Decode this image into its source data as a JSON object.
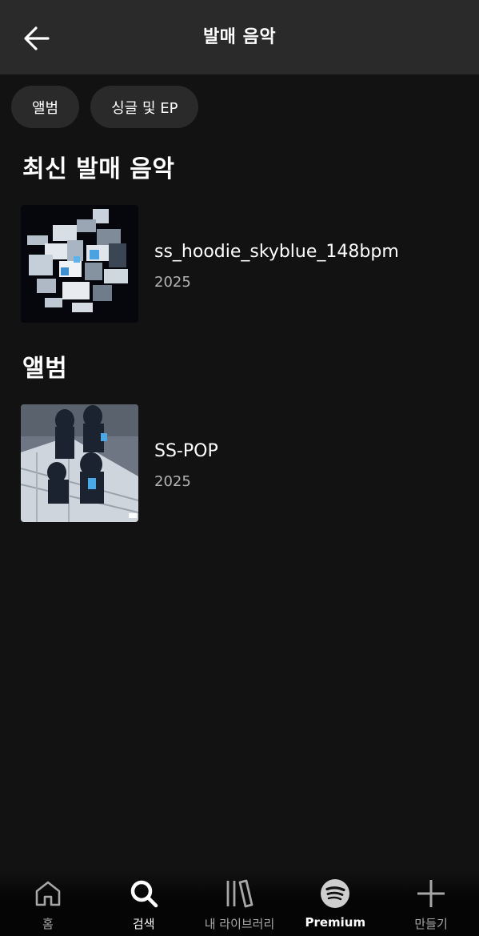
{
  "header": {
    "title": "발매 음악"
  },
  "filters": [
    {
      "label": "앨범"
    },
    {
      "label": "싱글 및 EP"
    }
  ],
  "sections": [
    {
      "heading": "최신 발매 음악",
      "items": [
        {
          "title": "ss_hoodie_skyblue_148bpm",
          "year": "2025"
        }
      ]
    },
    {
      "heading": "앨범",
      "items": [
        {
          "title": "SS-POP",
          "year": "2025"
        }
      ]
    }
  ],
  "bottom_nav": [
    {
      "label": "홈",
      "icon": "home-icon"
    },
    {
      "label": "검색",
      "icon": "search-icon",
      "active": true
    },
    {
      "label": "내 라이브러리",
      "icon": "library-icon"
    },
    {
      "label": "Premium",
      "icon": "spotify-logo-icon"
    },
    {
      "label": "만들기",
      "icon": "plus-icon"
    }
  ],
  "colors": {
    "background": "#121212",
    "header": "#2a2a2a",
    "chip": "#2a2a2a",
    "subtext": "#b3b3b3"
  }
}
